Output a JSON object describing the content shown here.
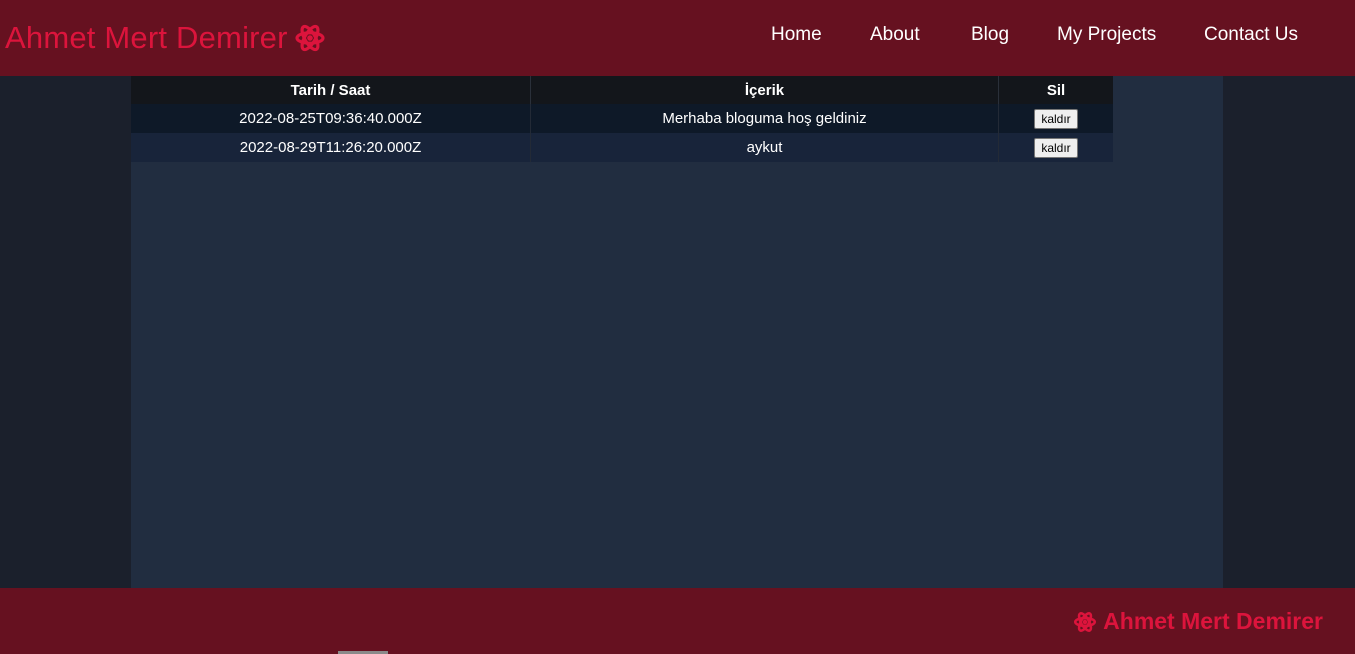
{
  "brand": {
    "name": "Ahmet Mert Demirer",
    "icon": "react-atom-icon",
    "color": "#dc143c"
  },
  "nav": {
    "home": "Home",
    "about": "About",
    "blog": "Blog",
    "projects": "My Projects",
    "contact": "Contact Us"
  },
  "table": {
    "headers": {
      "date": "Tarih / Saat",
      "content": "İçerik",
      "delete": "Sil"
    },
    "rows": [
      {
        "date": "2022-08-25T09:36:40.000Z",
        "content": "Merhaba bloguma hoş geldiniz",
        "action": "kaldır"
      },
      {
        "date": "2022-08-29T11:26:20.000Z",
        "content": "aykut",
        "action": "kaldır"
      }
    ]
  },
  "footer": {
    "name": "Ahmet Mert Demirer",
    "icon": "react-atom-icon"
  },
  "colors": {
    "bar": "#661120",
    "accent": "#dc143c",
    "page_bg": "#1b202c",
    "content_bg": "#212d40"
  }
}
